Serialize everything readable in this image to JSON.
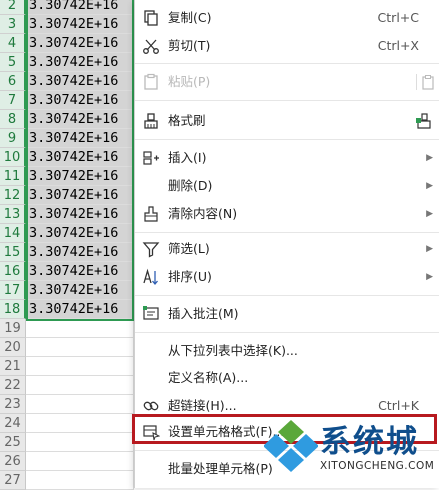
{
  "sheet": {
    "cell_value": "3.30742E+16",
    "rows": [
      {
        "num": "2",
        "value": "3.30742E+16",
        "selected": true
      },
      {
        "num": "3",
        "value": "3.30742E+16",
        "selected": true
      },
      {
        "num": "4",
        "value": "3.30742E+16",
        "selected": true
      },
      {
        "num": "5",
        "value": "3.30742E+16",
        "selected": true
      },
      {
        "num": "6",
        "value": "3.30742E+16",
        "selected": true
      },
      {
        "num": "7",
        "value": "3.30742E+16",
        "selected": true
      },
      {
        "num": "8",
        "value": "3.30742E+16",
        "selected": true
      },
      {
        "num": "9",
        "value": "3.30742E+16",
        "selected": true
      },
      {
        "num": "10",
        "value": "3.30742E+16",
        "selected": true
      },
      {
        "num": "11",
        "value": "3.30742E+16",
        "selected": true
      },
      {
        "num": "12",
        "value": "3.30742E+16",
        "selected": true
      },
      {
        "num": "13",
        "value": "3.30742E+16",
        "selected": true
      },
      {
        "num": "14",
        "value": "3.30742E+16",
        "selected": true
      },
      {
        "num": "15",
        "value": "3.30742E+16",
        "selected": true
      },
      {
        "num": "16",
        "value": "3.30742E+16",
        "selected": true
      },
      {
        "num": "17",
        "value": "3.30742E+16",
        "selected": true
      },
      {
        "num": "18",
        "value": "3.30742E+16",
        "selected": true
      },
      {
        "num": "19",
        "value": "",
        "selected": false
      },
      {
        "num": "20",
        "value": "",
        "selected": false
      },
      {
        "num": "21",
        "value": "",
        "selected": false
      },
      {
        "num": "22",
        "value": "",
        "selected": false
      },
      {
        "num": "23",
        "value": "",
        "selected": false
      },
      {
        "num": "24",
        "value": "",
        "selected": false
      },
      {
        "num": "25",
        "value": "",
        "selected": false
      },
      {
        "num": "26",
        "value": "",
        "selected": false
      },
      {
        "num": "27",
        "value": "",
        "selected": false
      }
    ],
    "colors": {
      "selection_border": "#2e9a52",
      "selected_fill": "#d4d4d4"
    }
  },
  "menu": {
    "copy": {
      "label": "复制(C)",
      "shortcut": "Ctrl+C",
      "icon": "copy-icon"
    },
    "cut": {
      "label": "剪切(T)",
      "shortcut": "Ctrl+X",
      "icon": "scissors-icon"
    },
    "paste": {
      "label": "粘贴(P)",
      "icon": "paste-icon",
      "disabled": true
    },
    "format_painter": {
      "label": "格式刷",
      "icon": "brush-icon"
    },
    "insert": {
      "label": "插入(I)",
      "icon": "insert-cells-icon"
    },
    "delete": {
      "label": "删除(D)"
    },
    "clear": {
      "label": "清除内容(N)",
      "icon": "eraser-icon"
    },
    "filter": {
      "label": "筛选(L)",
      "icon": "filter-icon"
    },
    "sort": {
      "label": "排序(U)",
      "icon": "sort-icon"
    },
    "insert_comment": {
      "label": "插入批注(M)",
      "icon": "comment-icon"
    },
    "pick_from_list": {
      "label": "从下拉列表中选择(K)..."
    },
    "define_name": {
      "label": "定义名称(A)..."
    },
    "hyperlink": {
      "label": "超链接(H)...",
      "shortcut": "Ctrl+K",
      "icon": "link-icon"
    },
    "format_cells": {
      "label": "设置单元格格式(F)...",
      "icon": "format-cells-icon"
    },
    "batch": {
      "label": "批量处理单元格(P)"
    },
    "highlight_color": "#b7191f"
  },
  "watermark": {
    "brand": "系统城",
    "url": "XITONGCHENG.COM"
  }
}
